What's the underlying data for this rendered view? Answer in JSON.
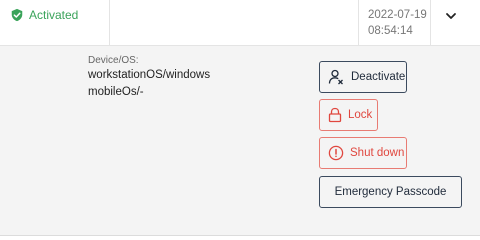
{
  "row": {
    "status": "Activated",
    "status_color": "#3aa35a",
    "date": "2022-07-19",
    "time": "08:54:14",
    "expand_icon": "chevron-down-icon"
  },
  "details": {
    "device_label": "Device/OS:",
    "devices": [
      "workstationOS/windows",
      "mobileOs/-"
    ]
  },
  "actions": {
    "deactivate": "Deactivate",
    "lock": "Lock",
    "shutdown": "Shut down",
    "emergency": "Emergency Passcode"
  },
  "colors": {
    "accent_dark": "#3b4a5e",
    "danger": "#e0473f",
    "panel_bg": "#f4f4f4"
  }
}
